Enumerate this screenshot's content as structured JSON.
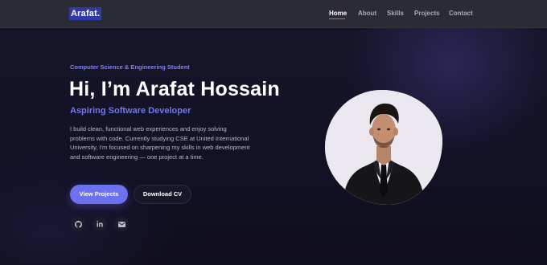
{
  "brand": {
    "logo_text": "Arafat."
  },
  "nav": {
    "items": [
      {
        "label": "Home",
        "active": true
      },
      {
        "label": "About",
        "active": false
      },
      {
        "label": "Skills",
        "active": false
      },
      {
        "label": "Projects",
        "active": false
      },
      {
        "label": "Contact",
        "active": false
      }
    ]
  },
  "hero": {
    "eyebrow": "Computer Science & Engineering Student",
    "headline": "Hi, I’m Arafat Hossain",
    "subtitle": "Aspiring Software Developer",
    "bio": "I build clean, functional web experiences and enjoy solving problems with code. Currently studying CSE at United International University, I'm focused on sharpening my skills in web development and software engineering — one project at a time.",
    "primary_button": "View Projects",
    "secondary_button": "Download CV"
  },
  "socials": [
    {
      "icon": "github-icon"
    },
    {
      "icon": "linkedin-icon"
    },
    {
      "icon": "email-icon"
    }
  ],
  "colors": {
    "accent": "#6c71ef",
    "background": "#0f0e1c",
    "navbar": "#2b2b35",
    "logo_bg": "#2f3aa8"
  }
}
